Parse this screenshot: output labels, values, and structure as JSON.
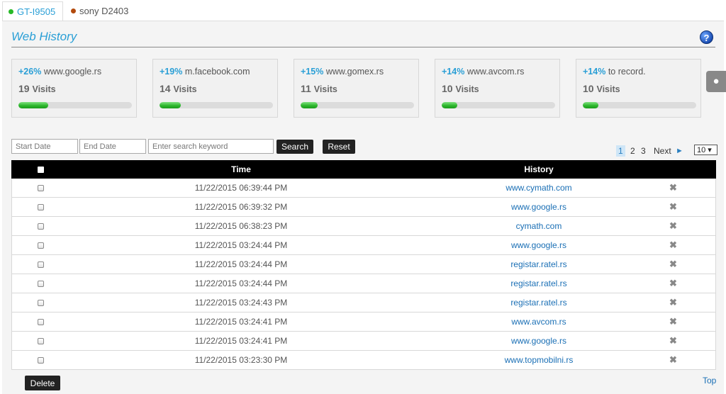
{
  "tabs": [
    {
      "label": "GT-I9505",
      "dot_color": "#27b927",
      "active": true
    },
    {
      "label": "sony D2403",
      "dot_color": "#b24a0d",
      "active": false
    }
  ],
  "page": {
    "title": "Web History",
    "help_icon": "help-icon",
    "side_icon": "globe-icon"
  },
  "stats": [
    {
      "pct": "+26%",
      "site": "www.google.rs",
      "visits": "19",
      "visits_label": "Visits",
      "fill": 0.26
    },
    {
      "pct": "+19%",
      "site": "m.facebook.com",
      "visits": "14",
      "visits_label": "Visits",
      "fill": 0.19
    },
    {
      "pct": "+15%",
      "site": "www.gomex.rs",
      "visits": "11",
      "visits_label": "Visits",
      "fill": 0.15
    },
    {
      "pct": "+14%",
      "site": "www.avcom.rs",
      "visits": "10",
      "visits_label": "Visits",
      "fill": 0.14
    },
    {
      "pct": "+14%",
      "site": "to record.",
      "visits": "10",
      "visits_label": "Visits",
      "fill": 0.14
    }
  ],
  "filters": {
    "start_placeholder": "Start Date",
    "end_placeholder": "End Date",
    "search_placeholder": "Enter search keyword",
    "search_label": "Search",
    "reset_label": "Reset"
  },
  "pagination": {
    "pages": [
      "1",
      "2",
      "3"
    ],
    "current": "1",
    "next_label": "Next",
    "per_page": "10 ▾"
  },
  "table": {
    "headers": {
      "time": "Time",
      "history": "History"
    },
    "rows": [
      {
        "time": "11/22/2015 06:39:44 PM",
        "url": "www.cymath.com"
      },
      {
        "time": "11/22/2015 06:39:32 PM",
        "url": "www.google.rs"
      },
      {
        "time": "11/22/2015 06:38:23 PM",
        "url": "cymath.com"
      },
      {
        "time": "11/22/2015 03:24:44 PM",
        "url": "www.google.rs"
      },
      {
        "time": "11/22/2015 03:24:44 PM",
        "url": "registar.ratel.rs"
      },
      {
        "time": "11/22/2015 03:24:44 PM",
        "url": "registar.ratel.rs"
      },
      {
        "time": "11/22/2015 03:24:43 PM",
        "url": "registar.ratel.rs"
      },
      {
        "time": "11/22/2015 03:24:41 PM",
        "url": "www.avcom.rs"
      },
      {
        "time": "11/22/2015 03:24:41 PM",
        "url": "www.google.rs"
      },
      {
        "time": "11/22/2015 03:23:30 PM",
        "url": "www.topmobilni.rs"
      }
    ]
  },
  "footer": {
    "delete_label": "Delete",
    "top_label": "Top"
  }
}
